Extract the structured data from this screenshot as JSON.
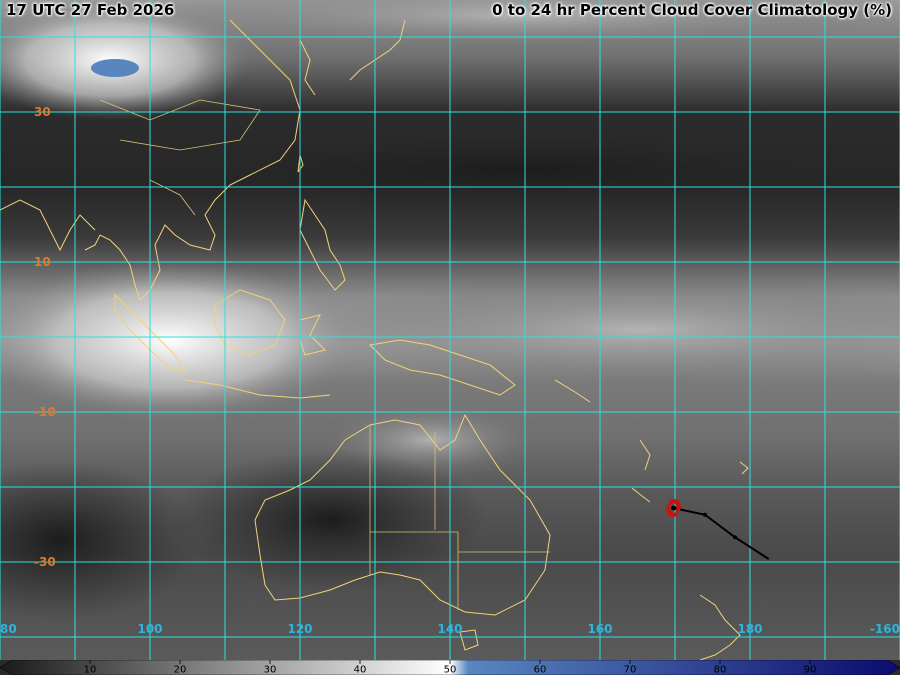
{
  "header": {
    "timestamp": "17 UTC 27 Feb 2026",
    "product_title": "0 to 24 hr Percent Cloud Cover Climatology (%)"
  },
  "lat_labels": [
    {
      "value": 30,
      "text": "30"
    },
    {
      "value": 10,
      "text": "10"
    },
    {
      "value": -10,
      "text": "-10"
    },
    {
      "value": -30,
      "text": "-30"
    }
  ],
  "lon_labels": [
    {
      "value": 80,
      "text": "80"
    },
    {
      "value": 100,
      "text": "100"
    },
    {
      "value": 120,
      "text": "120"
    },
    {
      "value": 140,
      "text": "140"
    },
    {
      "value": 160,
      "text": "160"
    },
    {
      "value": 180,
      "text": "180"
    },
    {
      "value": 200,
      "text": "-160"
    }
  ],
  "colorbar": {
    "ticks": [
      "10",
      "20",
      "30",
      "40",
      "50",
      "60",
      "70",
      "80",
      "90"
    ]
  },
  "storm_track": [
    {
      "lon": 169.8,
      "lat": -22.8
    },
    {
      "lon": 174.0,
      "lat": -23.7
    },
    {
      "lon": 178.0,
      "lat": -26.7
    },
    {
      "lon": 182.5,
      "lat": -29.6
    }
  ],
  "storm_symbol_position": {
    "lon": 169.8,
    "lat": -22.8
  },
  "colors": {
    "grid": "#2fe0e0",
    "coastline": "#f2d27a",
    "lat_label": "#e07a2a",
    "lon_label": "#2ab6e0",
    "storm_symbol": "#cc1111",
    "storm_track": "#000000",
    "colorbar_low": "#1a1a1a",
    "colorbar_mid": "#ffffff",
    "colorbar_high": "#0b0b6e"
  },
  "icons": {
    "storm": "tropical-cyclone-icon"
  }
}
